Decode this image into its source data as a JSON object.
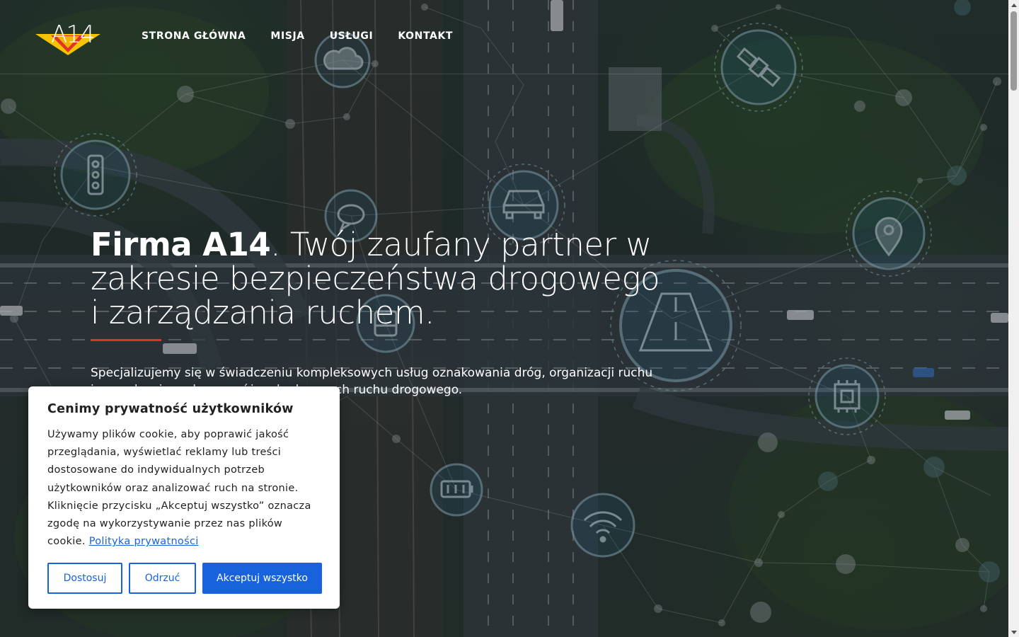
{
  "nav": {
    "logo_text": "A14",
    "items": [
      {
        "label": "STRONA GŁÓWNA"
      },
      {
        "label": "MISJA"
      },
      {
        "label": "USŁUGI"
      },
      {
        "label": "KONTAKT"
      }
    ]
  },
  "hero": {
    "headline_brand": "Firma A14",
    "headline_rest": ". Twój zaufany partner w zakresie bezpieczeństwa drogowego i zarządzania ruchem.",
    "lead": "Specjalizujemy się w świadczeniu kompleksowych usług oznakowania dróg, organizacji ruchu i zarządzania ruchem w różnych obszarach ruchu drogowego."
  },
  "cookie": {
    "title": "Cenimy prywatność użytkowników",
    "body": "Używamy plików cookie, aby poprawić jakość przeglądania, wyświetlać reklamy lub treści dostosowane do indywidualnych potrzeb użytkowników oraz analizować ruch na stronie. Kliknięcie przycisku „Akceptuj wszystko” oznacza zgodę na wykorzystywanie przez nas plików cookie.",
    "policy_link": "Polityka prywatności",
    "btn_customize": "Dostosuj",
    "btn_reject": "Odrzuć",
    "btn_accept": "Akceptuj wszystko"
  },
  "colors": {
    "accent": "#e0312a",
    "button_blue": "#1863dc",
    "logo_yellow": "#f5c400"
  },
  "icons": [
    "traffic-light-icon",
    "cloud-icon",
    "chat-icon",
    "car-icon",
    "satellite-icon",
    "location-pin-icon",
    "road-icon",
    "chip-icon",
    "battery-icon",
    "wifi-icon",
    "bus-icon"
  ]
}
